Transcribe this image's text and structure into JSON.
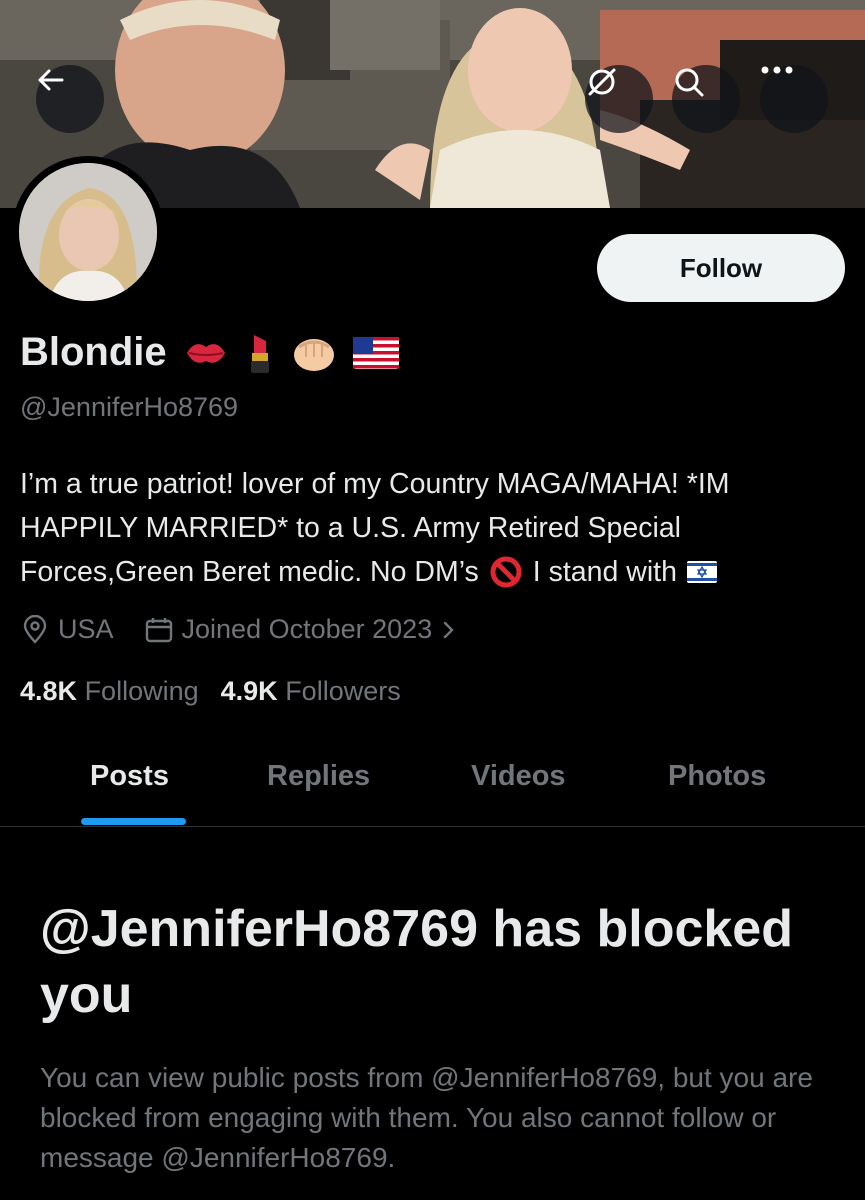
{
  "banner": {
    "back_icon": "arrow-left-icon",
    "translate_icon": "translate-off-icon",
    "search_icon": "search-icon",
    "more_icon": "more-dots-icon"
  },
  "profile": {
    "follow_label": "Follow",
    "display_name": "Blondie",
    "name_emojis": [
      "kiss-mark-emoji",
      "lipstick-emoji",
      "fist-emoji",
      "us-flag-emoji"
    ],
    "handle": "@JenniferHo8769",
    "bio_lines": [
      "I’m a true patriot! lover of my Country MAGA/MAHA! *IM",
      "HAPPILY MARRIED* to a U.S. Army Retired Special",
      "Forces,Green Beret medic. No DM’s",
      "I stand with"
    ],
    "bio_emojis": [
      "prohibited-emoji",
      "israel-flag-emoji"
    ],
    "location": "USA",
    "joined": "Joined October 2023",
    "following_count": "4.8K",
    "following_label": "Following",
    "followers_count": "4.9K",
    "followers_label": "Followers"
  },
  "tabs": [
    {
      "label": "Posts",
      "active": true
    },
    {
      "label": "Replies",
      "active": false
    },
    {
      "label": "Videos",
      "active": false
    },
    {
      "label": "Photos",
      "active": false
    }
  ],
  "blocked": {
    "title": "@JenniferHo8769 has blocked you",
    "description": "You can view public posts from @JenniferHo8769, but you are blocked from engaging with them. You also cannot follow or message @JenniferHo8769."
  },
  "colors": {
    "background": "#000000",
    "primary_text": "#e7e9ea",
    "secondary_text": "#71767b",
    "accent": "#1d9bf0",
    "follow_bg": "#eff3f4"
  }
}
